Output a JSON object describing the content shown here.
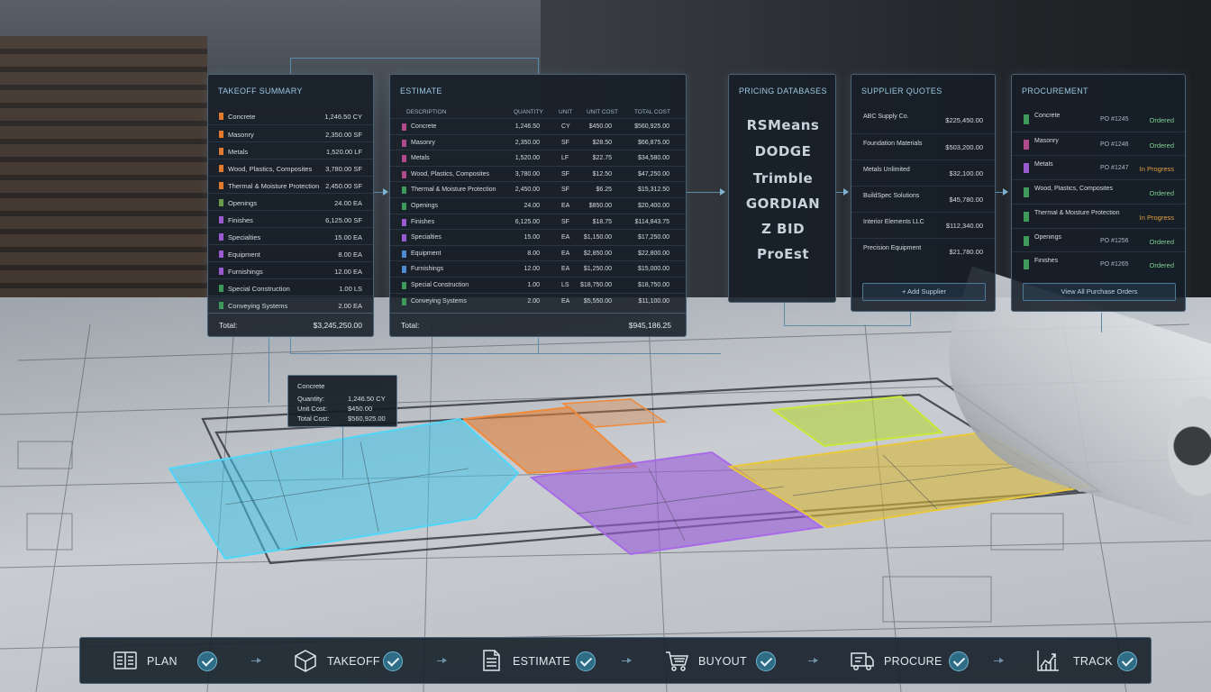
{
  "colors": {
    "concrete": "#e07a2e",
    "masonry": "#b04a8a",
    "metals": "#b25c2a",
    "wood": "#d06a3a",
    "thermal": "#c9813a",
    "openings": "#3d9a5a",
    "finishes": "#3d9a5a",
    "specialties": "#9a5ad0",
    "equipment": "#4d8ad0",
    "furnishings": "#8a5ab0",
    "special_construction": "#4aa05a",
    "conveying": "#5aa05a",
    "cyan": "#3fc4e8",
    "orange": "#e0803a",
    "purple": "#9a5ad8",
    "green_yellow": "#b6d43a",
    "yellow": "#d8b83a",
    "ordered": "#7fcf8f",
    "in_progress": "#e0a040"
  },
  "takeoff": {
    "title": "TAKEOFF SUMMARY",
    "rows": [
      {
        "label": "Concrete",
        "value": "1,246.50 CY",
        "color": "#e07a2e"
      },
      {
        "label": "Masonry",
        "value": "2,350.00 SF",
        "color": "#e07a2e"
      },
      {
        "label": "Metals",
        "value": "1,520.00 LF",
        "color": "#e07a2e"
      },
      {
        "label": "Wood, Plastics, Composites",
        "value": "3,780.00 SF",
        "color": "#e07a2e"
      },
      {
        "label": "Thermal & Moisture Protection",
        "value": "2,450.00 SF",
        "color": "#e07a2e"
      },
      {
        "label": "Openings",
        "value": "24.00 EA",
        "color": "#6a9a4a"
      },
      {
        "label": "Finishes",
        "value": "6,125.00 SF",
        "color": "#9a5ad0"
      },
      {
        "label": "Specialties",
        "value": "15.00 EA",
        "color": "#9a5ad0"
      },
      {
        "label": "Equipment",
        "value": "8.00 EA",
        "color": "#9a5ad0"
      },
      {
        "label": "Furnishings",
        "value": "12.00 EA",
        "color": "#9a5ad0"
      },
      {
        "label": "Special Construction",
        "value": "1.00 LS",
        "color": "#3d9a5a"
      },
      {
        "label": "Conveying Systems",
        "value": "2.00 EA",
        "color": "#3d9a5a"
      }
    ],
    "total_label": "Total:",
    "total_value": "$3,245,250.00"
  },
  "estimate": {
    "title": "ESTIMATE",
    "headers": {
      "description": "DESCRIPTION",
      "quantity": "QUANTITY",
      "unit": "UNIT",
      "unit_cost": "UNIT COST",
      "total_cost": "TOTAL COST"
    },
    "rows": [
      {
        "description": "Concrete",
        "quantity": "1,246.50",
        "unit": "CY",
        "unit_cost": "$450.00",
        "total_cost": "$560,925.00",
        "color": "#b04a8a"
      },
      {
        "description": "Masonry",
        "quantity": "2,350.00",
        "unit": "SF",
        "unit_cost": "$28.50",
        "total_cost": "$66,875.00",
        "color": "#b04a8a"
      },
      {
        "description": "Metals",
        "quantity": "1,520.00",
        "unit": "LF",
        "unit_cost": "$22.75",
        "total_cost": "$34,580.00",
        "color": "#b04a8a"
      },
      {
        "description": "Wood, Plastics, Composites",
        "quantity": "3,780.00",
        "unit": "SF",
        "unit_cost": "$12.50",
        "total_cost": "$47,250.00",
        "color": "#b04a8a"
      },
      {
        "description": "Thermal & Moisture Protection",
        "quantity": "2,450.00",
        "unit": "SF",
        "unit_cost": "$6.25",
        "total_cost": "$15,312.50",
        "color": "#3d9a5a"
      },
      {
        "description": "Openings",
        "quantity": "24.00",
        "unit": "EA",
        "unit_cost": "$850.00",
        "total_cost": "$20,400.00",
        "color": "#3d9a5a"
      },
      {
        "description": "Finishes",
        "quantity": "6,125.00",
        "unit": "SF",
        "unit_cost": "$18.75",
        "total_cost": "$114,843.75",
        "color": "#9a5ad0"
      },
      {
        "description": "Specialties",
        "quantity": "15.00",
        "unit": "EA",
        "unit_cost": "$1,150.00",
        "total_cost": "$17,250.00",
        "color": "#9a5ad0"
      },
      {
        "description": "Equipment",
        "quantity": "8.00",
        "unit": "EA",
        "unit_cost": "$2,850.00",
        "total_cost": "$22,800.00",
        "color": "#4d8ad0"
      },
      {
        "description": "Furnishings",
        "quantity": "12.00",
        "unit": "EA",
        "unit_cost": "$1,250.00",
        "total_cost": "$15,000.00",
        "color": "#4d8ad0"
      },
      {
        "description": "Special Construction",
        "quantity": "1.00",
        "unit": "LS",
        "unit_cost": "$18,750.00",
        "total_cost": "$18,750.00",
        "color": "#3d9a5a"
      },
      {
        "description": "Conveying Systems",
        "quantity": "2.00",
        "unit": "EA",
        "unit_cost": "$5,550.00",
        "total_cost": "$11,100.00",
        "color": "#3d9a5a"
      }
    ],
    "total_label": "Total:",
    "total_value": "$945,186.25"
  },
  "pricing": {
    "title": "PRICING DATABASES",
    "logos": [
      "RSMeans",
      "DODGE",
      "Trimble",
      "GORDIAN",
      "Z BID",
      "ProEst"
    ]
  },
  "suppliers": {
    "title": "SUPPLIER QUOTES",
    "rows": [
      {
        "name": "ABC Supply Co.",
        "amount": "$225,450.00"
      },
      {
        "name": "Foundation Materials",
        "amount": "$503,200.00"
      },
      {
        "name": "Metals Unlimited",
        "amount": "$32,100.00"
      },
      {
        "name": "BuildSpec Solutions",
        "amount": "$45,780.00"
      },
      {
        "name": "Interior Elements LLC",
        "amount": "$112,340.00"
      },
      {
        "name": "Precision Equipment",
        "amount": "$21,780.00"
      }
    ],
    "add_button": "+ Add Supplier"
  },
  "procurement": {
    "title": "PROCUREMENT",
    "rows": [
      {
        "item": "Concrete",
        "po": "PO #1245",
        "status": "Ordered",
        "state": "ordered",
        "color": "#3d9a5a"
      },
      {
        "item": "Masonry",
        "po": "PO #1246",
        "status": "Ordered",
        "state": "ordered",
        "color": "#b04a8a"
      },
      {
        "item": "Metals",
        "po": "PO #1247",
        "status": "In Progress",
        "state": "progress",
        "color": "#9a5ad0"
      },
      {
        "item": "Wood, Plastics, Composites",
        "po": "",
        "status": "Ordered",
        "state": "ordered",
        "color": "#3d9a5a"
      },
      {
        "item": "Thermal & Moisture Protection",
        "po": "",
        "status": "In Progress",
        "state": "progress",
        "color": "#3d9a5a"
      },
      {
        "item": "Openings",
        "po": "PO #1256",
        "status": "Ordered",
        "state": "ordered",
        "color": "#3d9a5a"
      },
      {
        "item": "Finishes",
        "po": "PO #1265",
        "status": "Ordered",
        "state": "ordered",
        "color": "#3d9a5a"
      }
    ],
    "view_button": "View All Purchase Orders"
  },
  "tooltip": {
    "title": "Concrete",
    "quantity_label": "Quantity:",
    "quantity_value": "1,246.50 CY",
    "unit_cost_label": "Unit Cost:",
    "unit_cost_value": "$450.00",
    "total_cost_label": "Total Cost:",
    "total_cost_value": "$560,925.00"
  },
  "workflow": {
    "steps": [
      {
        "label": "PLAN",
        "icon": "book-icon"
      },
      {
        "label": "TAKEOFF",
        "icon": "cube-icon"
      },
      {
        "label": "ESTIMATE",
        "icon": "document-icon"
      },
      {
        "label": "BUYOUT",
        "icon": "cart-icon"
      },
      {
        "label": "PROCURE",
        "icon": "truck-icon"
      },
      {
        "label": "TRACK",
        "icon": "chart-icon"
      }
    ]
  }
}
